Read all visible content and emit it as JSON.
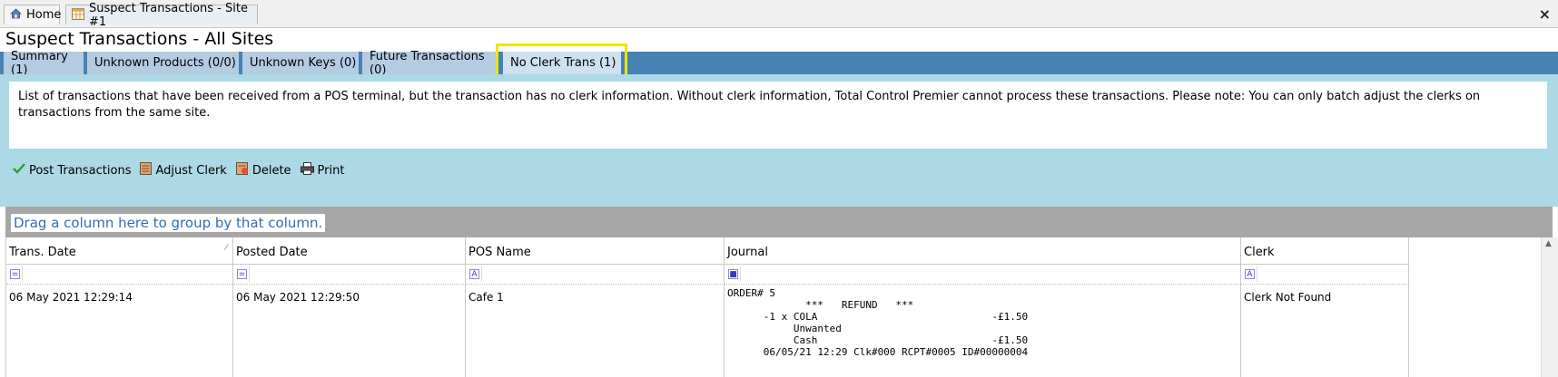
{
  "doc_tabs": [
    {
      "label": "Home",
      "icon": "home-icon"
    },
    {
      "label": "Suspect Transactions - Site #1",
      "icon": "grid-icon"
    }
  ],
  "close_label": "×",
  "page_title": "Suspect Transactions - All Sites",
  "tabs": [
    {
      "label": "Summary (1)"
    },
    {
      "label": "Unknown Products (0/0)"
    },
    {
      "label": "Unknown Keys (0)"
    },
    {
      "label": "Future Transactions (0)"
    },
    {
      "label": "No Clerk Trans (1)",
      "active": true
    }
  ],
  "description": "List of transactions that have been received from a POS terminal, but the transaction has no clerk information.  Without clerk information, Total Control Premier cannot process these transactions.  Please note: You can only batch adjust the clerks on transactions from the same site.",
  "toolbar": {
    "post": "Post Transactions",
    "adjust": "Adjust Clerk",
    "delete": "Delete",
    "print": "Print"
  },
  "group_hint": "Drag a column here to group by that column.",
  "columns": [
    "Trans. Date",
    "Posted Date",
    "POS Name",
    "Journal",
    "Clerk"
  ],
  "filter_icons": [
    "=",
    "=",
    "A",
    "■",
    "A"
  ],
  "rows": [
    {
      "trans_date": "06 May 2021 12:29:14",
      "posted_date": "06 May 2021 12:29:50",
      "pos_name": "Cafe 1",
      "journal": "ORDER# 5\n             ***   REFUND   ***\n      -1 x COLA                             -£1.50\n           Unwanted\n           Cash                             -£1.50\n      06/05/21 12:29 Clk#000 RCPT#0005 ID#00000004",
      "clerk": "Clerk Not Found"
    }
  ],
  "colors": {
    "tab_bar": "#4682b4",
    "tab": "#b5cbe2",
    "panel": "#add8e6",
    "highlight": "#f0e600",
    "group_bar": "#a6a6a6",
    "link": "#2f6fb6"
  }
}
